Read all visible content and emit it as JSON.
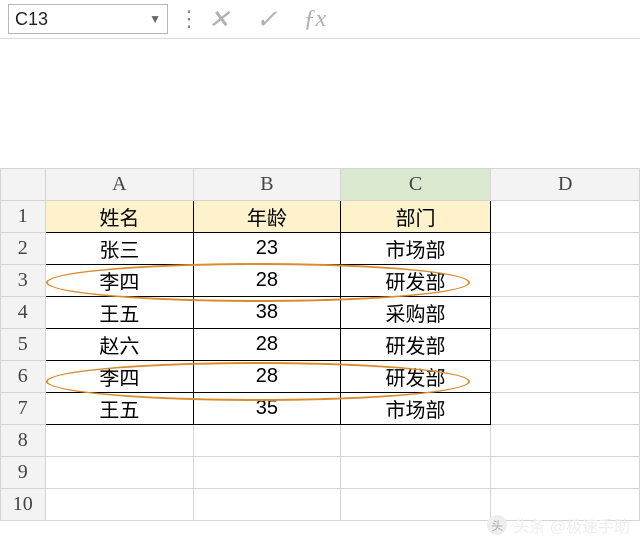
{
  "nameBox": {
    "value": "C13"
  },
  "columns": [
    "A",
    "B",
    "C",
    "D"
  ],
  "selectedColumn": "C",
  "rowCount": 10,
  "headerRow": {
    "A": "姓名",
    "B": "年龄",
    "C": "部门"
  },
  "dataRows": [
    {
      "A": "张三",
      "B": "23",
      "C": "市场部"
    },
    {
      "A": "李四",
      "B": "28",
      "C": "研发部"
    },
    {
      "A": "王五",
      "B": "38",
      "C": "采购部"
    },
    {
      "A": "赵六",
      "B": "28",
      "C": "研发部"
    },
    {
      "A": "李四",
      "B": "28",
      "C": "研发部"
    },
    {
      "A": "王五",
      "B": "35",
      "C": "市场部"
    }
  ],
  "highlightRows": [
    3,
    6
  ],
  "watermark": "头条 @极速手助",
  "chart_data": {
    "type": "table",
    "title": "",
    "columns": [
      "姓名",
      "年龄",
      "部门"
    ],
    "rows": [
      [
        "张三",
        23,
        "市场部"
      ],
      [
        "李四",
        28,
        "研发部"
      ],
      [
        "王五",
        38,
        "采购部"
      ],
      [
        "赵六",
        28,
        "研发部"
      ],
      [
        "李四",
        28,
        "研发部"
      ],
      [
        "王五",
        35,
        "市场部"
      ]
    ]
  }
}
